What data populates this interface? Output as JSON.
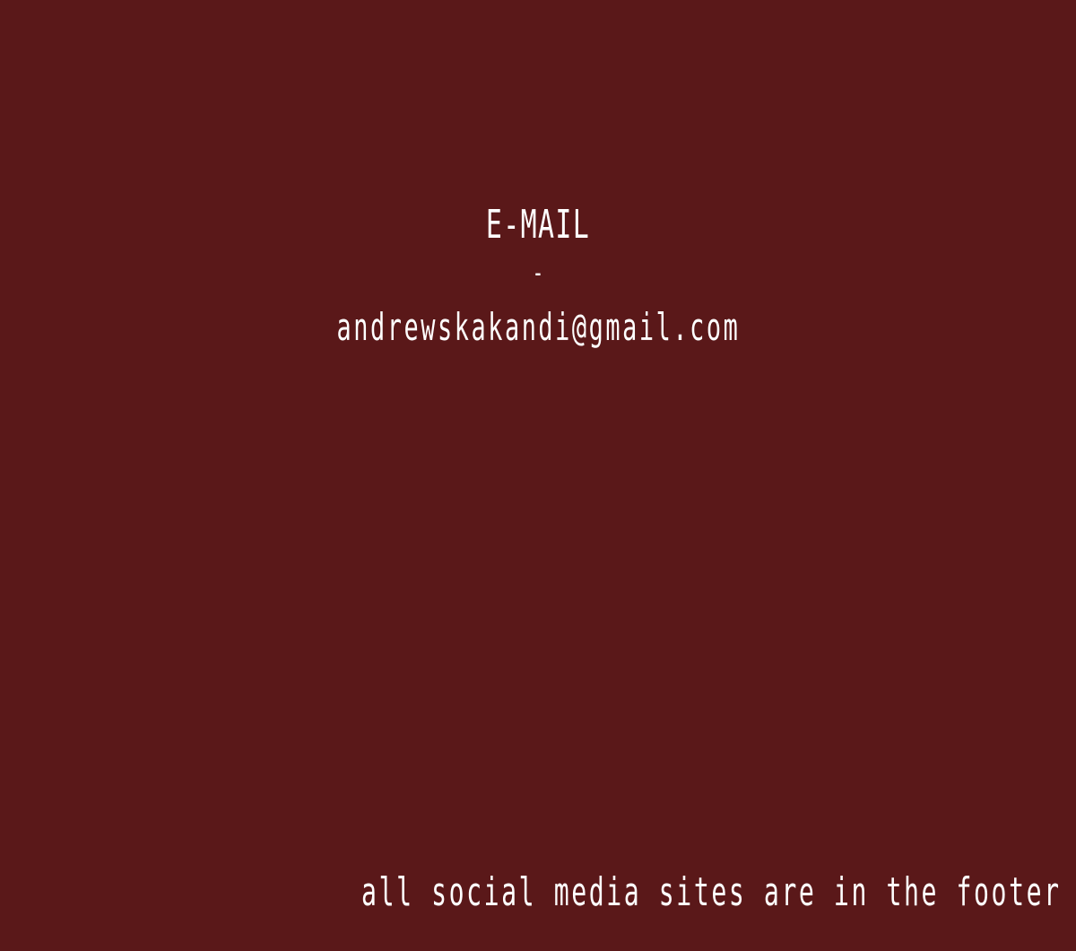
{
  "contact": {
    "label": "E-MAIL",
    "separator": "-",
    "email": "andrewskakandi@gmail.com"
  },
  "footer_note": "all social media sites are in the footer",
  "colors": {
    "background": "#5a1819",
    "text": "#ffffff"
  }
}
